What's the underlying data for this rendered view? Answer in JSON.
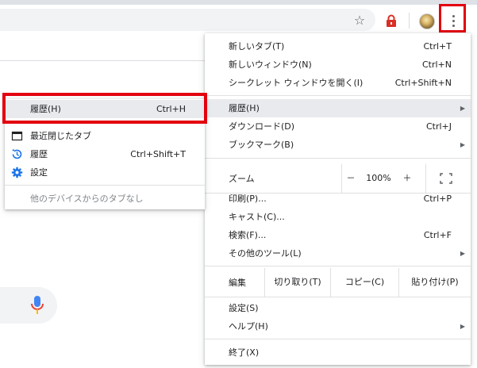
{
  "colors": {
    "highlight": "#e3000f",
    "mic_blue": "#4285f4",
    "mic_red": "#ea4335",
    "ext_red": "#d93025"
  },
  "toolbar": {
    "bookmark_icon": "star-icon",
    "extension_icon": "red-lock-icon",
    "profile_icon": "avatar",
    "menu_icon": "kebab-menu-icon"
  },
  "menu": {
    "new_tab": {
      "label": "新しいタブ(T)",
      "shortcut": "Ctrl+T"
    },
    "new_window": {
      "label": "新しいウィンドウ(N)",
      "shortcut": "Ctrl+N"
    },
    "incognito": {
      "label": "シークレット ウィンドウを開く(I)",
      "shortcut": "Ctrl+Shift+N"
    },
    "history": {
      "label": "履歴(H)",
      "arrow": "▶"
    },
    "downloads": {
      "label": "ダウンロード(D)",
      "shortcut": "Ctrl+J"
    },
    "bookmarks": {
      "label": "ブックマーク(B)",
      "arrow": "▶"
    },
    "zoom": {
      "label": "ズーム",
      "minus": "－",
      "value": "100%",
      "plus": "＋"
    },
    "print": {
      "label": "印刷(P)...",
      "shortcut": "Ctrl+P"
    },
    "cast": {
      "label": "キャスト(C)..."
    },
    "find": {
      "label": "検索(F)...",
      "shortcut": "Ctrl+F"
    },
    "more_tools": {
      "label": "その他のツール(L)",
      "arrow": "▶"
    },
    "edit": {
      "label": "編集",
      "cut": "切り取り(T)",
      "copy": "コピー(C)",
      "paste": "貼り付け(P)"
    },
    "settings": {
      "label": "設定(S)"
    },
    "help": {
      "label": "ヘルプ(H)",
      "arrow": "▶"
    },
    "exit": {
      "label": "終了(X)"
    }
  },
  "submenu": {
    "history": {
      "label": "履歴(H)",
      "shortcut": "Ctrl+H"
    },
    "recently_closed": {
      "label": "最近閉じたタブ"
    },
    "history2": {
      "label": "履歴",
      "shortcut": "Ctrl+Shift+T"
    },
    "settings": {
      "label": "設定"
    },
    "no_tabs": {
      "label": "他のデバイスからのタブなし"
    }
  }
}
